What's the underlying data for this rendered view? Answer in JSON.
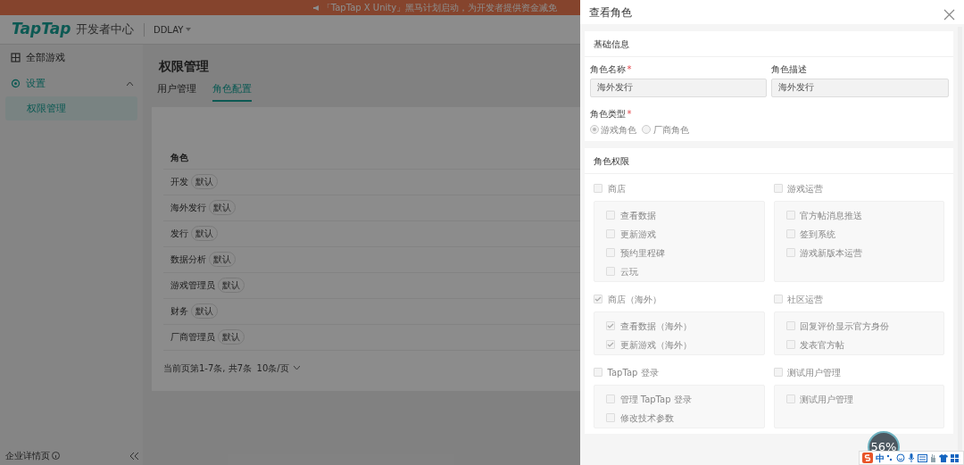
{
  "banner": {
    "text": "「TapTap X Unity」黑马计划启动，为开发者提供资金减免"
  },
  "header": {
    "logo": "TapTap",
    "subtitle": "开发者中心",
    "account": "DDLAY"
  },
  "sidebar": {
    "items": [
      {
        "label": "全部游戏",
        "expanded": false
      },
      {
        "label": "设置",
        "expanded": true,
        "children": [
          {
            "label": "权限管理",
            "selected": true
          }
        ]
      }
    ],
    "footer": "企业详情页"
  },
  "page": {
    "title": "权限管理",
    "tabs": [
      {
        "label": "用户管理",
        "selected": false
      },
      {
        "label": "角色配置",
        "selected": true
      }
    ],
    "table": {
      "columns": [
        "角色"
      ],
      "rows": [
        {
          "name": "开发",
          "tag": "默认"
        },
        {
          "name": "海外发行",
          "tag": "默认"
        },
        {
          "name": "发行",
          "tag": "默认"
        },
        {
          "name": "数据分析",
          "tag": "默认"
        },
        {
          "name": "游戏管理员",
          "tag": "默认"
        },
        {
          "name": "财务",
          "tag": "默认"
        },
        {
          "name": "厂商管理员",
          "tag": "默认"
        }
      ]
    },
    "pagination": {
      "summary": "当前页第1-7条, 共7条",
      "page_size": "10条/页"
    }
  },
  "drawer": {
    "title": "查看角色",
    "basic": {
      "title": "基础信息",
      "fields": [
        {
          "label": "角色名称",
          "required_mark": "*",
          "value": "海外发行"
        },
        {
          "label": "角色描述",
          "value": "海外发行"
        }
      ],
      "role_type": {
        "label": "角色类型",
        "required_mark": "*",
        "options": [
          {
            "label": "游戏角色",
            "selected": true
          },
          {
            "label": "厂商角色",
            "selected": false
          }
        ]
      }
    },
    "permissions": {
      "title": "角色权限",
      "groups": [
        {
          "label": "商店",
          "checked": false,
          "items": [
            {
              "label": "查看数据",
              "checked": false
            },
            {
              "label": "更新游戏",
              "checked": false
            },
            {
              "label": "预约里程碑",
              "checked": false
            },
            {
              "label": "云玩",
              "checked": false
            }
          ]
        },
        {
          "label": "游戏运营",
          "checked": false,
          "items": [
            {
              "label": "官方帖消息推送",
              "checked": false
            },
            {
              "label": "签到系统",
              "checked": false
            },
            {
              "label": "游戏新版本运营",
              "checked": false
            }
          ]
        },
        {
          "label": "商店（海外）",
          "checked": true,
          "items": [
            {
              "label": "查看数据（海外）",
              "checked": true
            },
            {
              "label": "更新游戏（海外）",
              "checked": true
            }
          ]
        },
        {
          "label": "社区运营",
          "checked": false,
          "items": [
            {
              "label": "回复评价显示官方身份",
              "checked": false
            },
            {
              "label": "发表官方帖",
              "checked": false
            }
          ]
        },
        {
          "label": "TapTap 登录",
          "checked": false,
          "items": [
            {
              "label": "管理 TapTap 登录",
              "checked": false
            },
            {
              "label": "修改技术参数",
              "checked": false
            }
          ]
        },
        {
          "label": "测试用户管理",
          "checked": false,
          "items": [
            {
              "label": "测试用户管理",
              "checked": false
            }
          ]
        }
      ]
    }
  },
  "speed_badge": {
    "text": "56%"
  },
  "ime_bar": {
    "mode": "中"
  }
}
